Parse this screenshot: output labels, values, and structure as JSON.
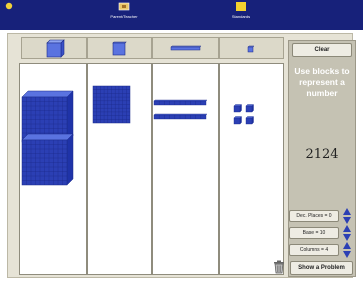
{
  "topbar": {
    "items": [
      {
        "label": "Parent/Teacher",
        "icon": "parent-teacher-icon"
      },
      {
        "label": "Standards",
        "icon": "standards-icon"
      }
    ]
  },
  "columns": [
    {
      "name": "thousands",
      "icon": "cube-icon",
      "count": 2
    },
    {
      "name": "hundreds",
      "icon": "flat-icon",
      "count": 1
    },
    {
      "name": "tens",
      "icon": "rod-icon",
      "count": 2
    },
    {
      "name": "ones",
      "icon": "unit-icon",
      "count": 4
    }
  ],
  "panel": {
    "clear_label": "Clear",
    "instruction": "Use blocks to represent a number",
    "number": "2124",
    "dec_places_label": "Dec. Places = 0",
    "base_label": "Base = 10",
    "columns_label": "Columns = 4",
    "show_problem_label": "Show a Problem"
  },
  "colors": {
    "topbar": "#17217a",
    "block": "#2b3fb4",
    "block_light": "#5a73e0",
    "panel": "#c5c2b3"
  }
}
